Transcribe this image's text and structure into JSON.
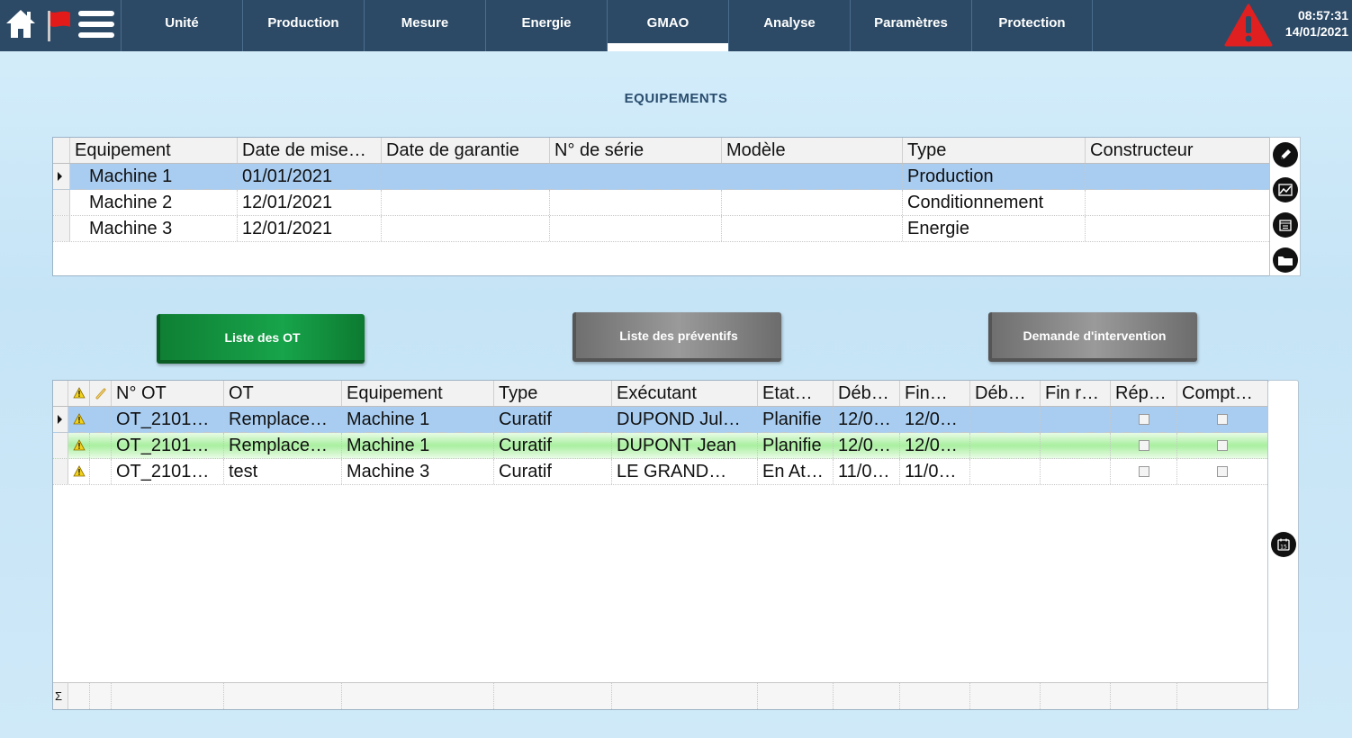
{
  "nav": {
    "tabs": [
      {
        "label": "Unité"
      },
      {
        "label": "Production"
      },
      {
        "label": "Mesure"
      },
      {
        "label": "Energie"
      },
      {
        "label": "GMAO",
        "active": true
      },
      {
        "label": "Analyse"
      },
      {
        "label": "Paramètres"
      },
      {
        "label": "Protection"
      }
    ],
    "time": "08:57:31",
    "date": "14/01/2021",
    "icons": [
      "home-icon",
      "flag-icon",
      "menu-icon",
      "alert-icon"
    ]
  },
  "page": {
    "title": "EQUIPEMENTS"
  },
  "equipment_grid": {
    "columns": [
      "Equipement",
      "Date de mise…",
      "Date de garantie",
      "N° de série",
      "Modèle",
      "Type",
      "Constructeur"
    ],
    "rows": [
      {
        "equipement": "Machine 1",
        "date_mise": "01/01/2021",
        "garantie": "",
        "serie": "",
        "modele": "",
        "type": "Production",
        "constructeur": "",
        "selected": true
      },
      {
        "equipement": "Machine 2",
        "date_mise": "12/01/2021",
        "garantie": "",
        "serie": "",
        "modele": "",
        "type": "Conditionnement",
        "constructeur": ""
      },
      {
        "equipement": "Machine 3",
        "date_mise": "12/01/2021",
        "garantie": "",
        "serie": "",
        "modele": "",
        "type": "Energie",
        "constructeur": ""
      }
    ],
    "side_icons": [
      "edit-icon",
      "chart-icon",
      "calendar-list-icon",
      "folder-icon"
    ]
  },
  "buttons": {
    "liste_ot": "Liste des OT",
    "liste_preventifs": "Liste des préventifs",
    "demande_intervention": "Demande d'intervention"
  },
  "ot_grid": {
    "columns": [
      "N° OT",
      "OT",
      "Equipement",
      "Type",
      "Exécutant",
      "Etat…",
      "Déb…",
      "Fin…",
      "Déb…",
      "Fin r…",
      "Rép…",
      "Compt…"
    ],
    "rows": [
      {
        "num": "OT_2101…",
        "ot": "Remplace…",
        "equipement": "Machine 1",
        "type": "Curatif",
        "executant": "DUPOND Jul…",
        "etat": "Planifie",
        "deb": "12/0…",
        "fin": "12/0…",
        "deb_r": "",
        "fin_r": "",
        "selected": true
      },
      {
        "num": "OT_2101…",
        "ot": "Remplace…",
        "equipement": "Machine 1",
        "type": "Curatif",
        "executant": "DUPONT Jean",
        "etat": "Planifie",
        "deb": "12/0…",
        "fin": "12/0…",
        "deb_r": "",
        "fin_r": "",
        "highlight": "green"
      },
      {
        "num": "OT_2101…",
        "ot": "test",
        "equipement": "Machine 3",
        "type": "Curatif",
        "executant": "LE GRAND…",
        "etat": "En At…",
        "deb": "11/0…",
        "fin": "11/0…",
        "deb_r": "",
        "fin_r": ""
      }
    ],
    "sum_symbol": "Σ",
    "side_icons": [
      "calendar-15-icon"
    ]
  }
}
